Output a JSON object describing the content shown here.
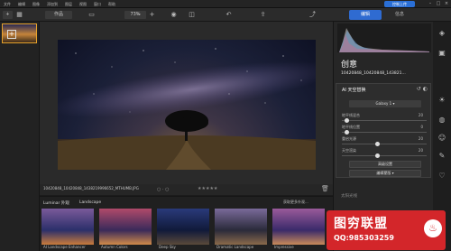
{
  "menubar": {
    "items": [
      "文件",
      "编辑",
      "图像",
      "添加到",
      "图层",
      "视图",
      "窗口",
      "帮助"
    ],
    "badge": "控制上传"
  },
  "toolbar": {
    "add_label": "+",
    "catalog_label": "作品",
    "zoom_value": "73%",
    "zoom_minus": "−",
    "zoom_plus": "+",
    "edit_tab": "编辑",
    "info_tab": "信息"
  },
  "photo": {
    "filename": "10420848_10420848_1438219996652_MTHUMB.JPG",
    "rating_dots": "○ · ○",
    "stars": "★★★★★"
  },
  "presets": {
    "tabs": [
      "Luminar 外观",
      "Landscape"
    ],
    "more_link": "获取更多外观...",
    "items": [
      {
        "name": "AI Landscape Enhancer",
        "colors": [
          "#7a5a9a",
          "#2b2f6a",
          "#c97b3b"
        ]
      },
      {
        "name": "Autumn Colors",
        "colors": [
          "#b04a6a",
          "#3a2a5a",
          "#d08a4a"
        ]
      },
      {
        "name": "Deep Sky",
        "colors": [
          "#2a3a7a",
          "#101a3a",
          "#5a4a3a"
        ]
      },
      {
        "name": "Dramatic Landscape",
        "colors": [
          "#7a6a9a",
          "#2a2a3a",
          "#8a6a4a"
        ]
      },
      {
        "name": "Impressive",
        "colors": [
          "#9a5a9a",
          "#3a2a6a",
          "#c88a5a"
        ]
      }
    ]
  },
  "right": {
    "section_title": "创意",
    "filename": "10420848_10420848_143821...",
    "ai_title": "AI 天空替换",
    "sky_value": "Galaxy 1 ▾",
    "sliders": [
      {
        "label": "地平线混合",
        "value": "20",
        "level": 0.05
      },
      {
        "label": "地平线位置",
        "value": "0",
        "level": 0.05
      },
      {
        "label": "重启光源",
        "value": "20",
        "level": 0.42
      },
      {
        "label": "天空渲染",
        "value": "20",
        "level": 0.42
      }
    ],
    "advanced_btn": "高级设置",
    "mask_btn": "编辑蒙版 ▾",
    "next_section": "太阳光线"
  },
  "watermark": {
    "title": "图穷联盟",
    "qq": "QQ:985303259"
  },
  "colors": {
    "accent": "#2f6bd1",
    "selection": "#e7a22b",
    "watermark": "#d3262a"
  }
}
